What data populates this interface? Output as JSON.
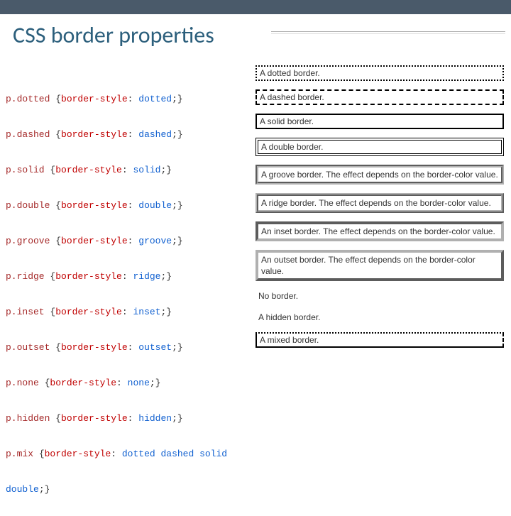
{
  "title": "CSS border properties",
  "code_lines": [
    {
      "sel": "p.dotted ",
      "prop": "border-style",
      "val": " dotted"
    },
    {
      "sel": "p.dashed ",
      "prop": "border-style",
      "val": " dashed"
    },
    {
      "sel": "p.solid ",
      "prop": "border-style",
      "val": " solid"
    },
    {
      "sel": "p.double ",
      "prop": "border-style",
      "val": " double"
    },
    {
      "sel": "p.groove ",
      "prop": "border-style",
      "val": " groove"
    },
    {
      "sel": "p.ridge ",
      "prop": "border-style",
      "val": " ridge"
    },
    {
      "sel": "p.inset ",
      "prop": "border-style",
      "val": " inset"
    },
    {
      "sel": "p.outset ",
      "prop": "border-style",
      "val": " outset"
    },
    {
      "sel": "p.none ",
      "prop": "border-style",
      "val": " none"
    },
    {
      "sel": "p.hidden ",
      "prop": "border-style",
      "val": " hidden"
    }
  ],
  "mix_line": {
    "sel": "p.mix ",
    "prop": "border-style",
    "val1": " dotted dashed solid",
    "val2": "double"
  },
  "previews": {
    "dotted": "A dotted border.",
    "dashed": "A dashed border.",
    "solid": "A solid border.",
    "double": "A double border.",
    "groove": "A groove border. The effect depends on the border-color value.",
    "ridge": "A ridge border. The effect depends on the border-color value.",
    "inset": "An inset border. The effect depends on the border-color value.",
    "outset": "An outset border. The effect depends on the border-color value.",
    "none": "No border.",
    "hidden": "A hidden border.",
    "mix": "A mixed border."
  }
}
